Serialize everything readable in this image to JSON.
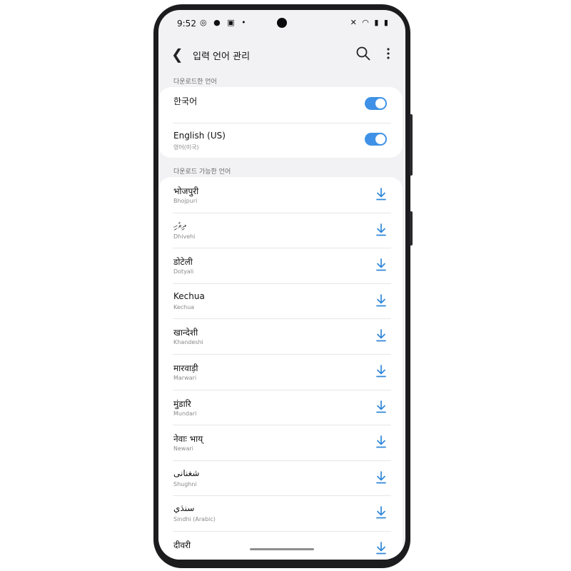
{
  "status_bar": {
    "time": "9:52",
    "left_icons": "◎ ● ▣ •",
    "right_icons": "✕ ◠ ▮ ▮"
  },
  "app_bar": {
    "title": "입력 언어 관리"
  },
  "downloaded": {
    "label": "다운로드한 언어",
    "items": [
      {
        "name": "한국어",
        "sub": "",
        "enabled": true
      },
      {
        "name": "English (US)",
        "sub": "영어(미국)",
        "enabled": true
      }
    ]
  },
  "available": {
    "label": "다운로드 가능한 언어",
    "items": [
      {
        "name": "भोजपुरी",
        "sub": "Bhojpuri"
      },
      {
        "name": "ދިވެހި",
        "sub": "Dhivehi"
      },
      {
        "name": "डोटेली",
        "sub": "Dotyali"
      },
      {
        "name": "Kechua",
        "sub": "Kechua"
      },
      {
        "name": "खान्देशी",
        "sub": "Khandeshi"
      },
      {
        "name": "मारवाड़ी",
        "sub": "Marwari"
      },
      {
        "name": "मुंडारि",
        "sub": "Mundari"
      },
      {
        "name": "नेवाः भाय्",
        "sub": "Newari"
      },
      {
        "name": "شغنانی",
        "sub": "Shughni"
      },
      {
        "name": "سنڌي",
        "sub": "Sindhi (Arabic)"
      },
      {
        "name": "दीवरी",
        "sub": ""
      }
    ]
  },
  "colors": {
    "accent": "#3e91e6",
    "background": "#f2f2f4",
    "card": "#ffffff"
  }
}
